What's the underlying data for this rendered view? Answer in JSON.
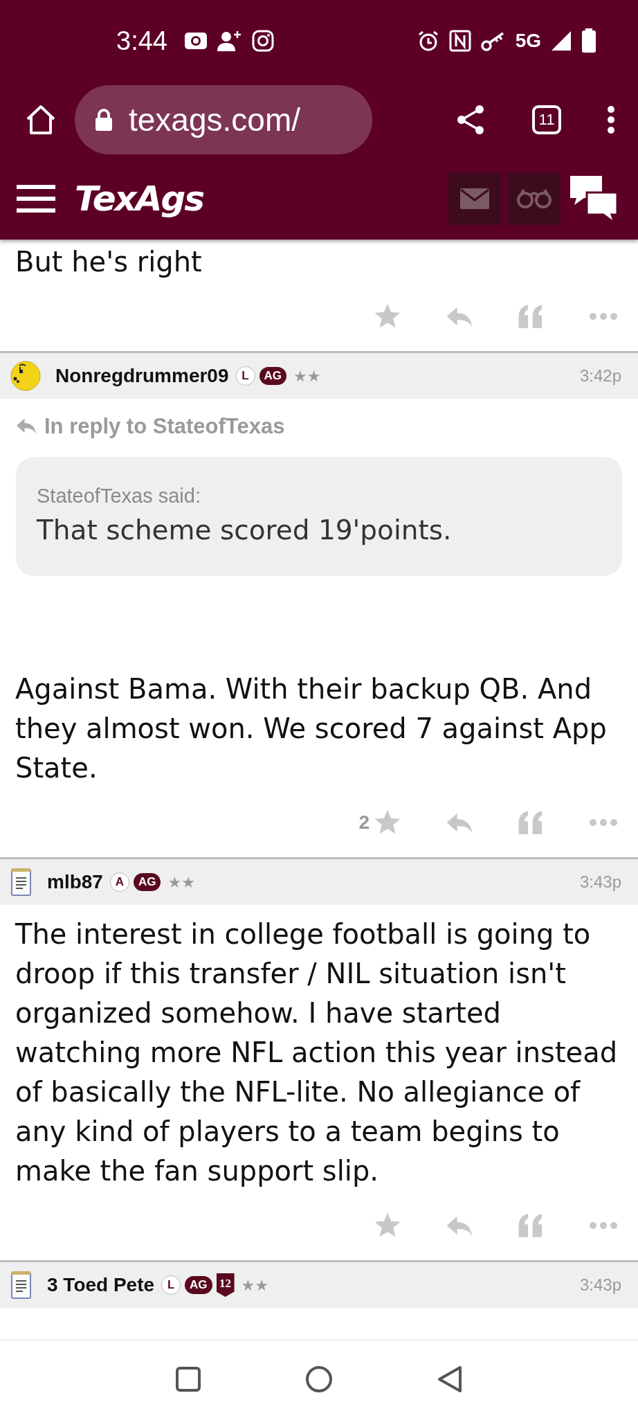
{
  "status_bar": {
    "time": "3:44",
    "network": "5G"
  },
  "browser": {
    "url": "texags.com/",
    "tab_count": "11"
  },
  "site_header": {
    "logo": "TexAgs"
  },
  "posts": [
    {
      "kind": "tail",
      "body": "But he's right"
    },
    {
      "kind": "full",
      "avatar": {
        "kind": "smiley"
      },
      "username": "Nonregdrummer09",
      "badges": [
        {
          "kind": "circle",
          "label": "L"
        },
        {
          "kind": "pill",
          "label": "AG"
        }
      ],
      "rank": "★★",
      "time": "3:42p",
      "reply_to": "In reply to StateofTexas",
      "quote": {
        "author": "StateofTexas said:",
        "text": "That scheme scored 19'points."
      },
      "body": "Against Bama. With their backup QB. And they almost won. We scored 7 against App State.",
      "likes": "2"
    },
    {
      "kind": "full",
      "avatar": {
        "kind": "notepad"
      },
      "username": "mlb87",
      "badges": [
        {
          "kind": "circle",
          "label": "A"
        },
        {
          "kind": "pill",
          "label": "AG"
        }
      ],
      "rank": "★★",
      "time": "3:43p",
      "body": "The interest in college football is going to droop if this transfer / NIL situation isn't organized somehow. I have started watching more NFL action this year instead of basically the NFL-lite. No allegiance of any kind of players to a team begins to make the fan support slip."
    },
    {
      "kind": "header",
      "avatar": {
        "kind": "notepad"
      },
      "username": "3 Toed Pete",
      "badges": [
        {
          "kind": "circle",
          "label": "L"
        },
        {
          "kind": "pill",
          "label": "AG"
        },
        {
          "kind": "shield",
          "label": "12"
        }
      ],
      "rank": "★★",
      "time": "3:43p"
    }
  ]
}
